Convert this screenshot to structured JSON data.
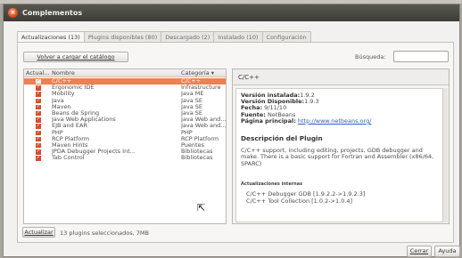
{
  "window": {
    "title": "Complementos",
    "close_icon": "close-icon"
  },
  "tabs": [
    {
      "label": "Actualizaciones (13)",
      "active": true
    },
    {
      "label": "Plugins disponibles (80)",
      "active": false
    },
    {
      "label": "Descargado (2)",
      "active": false
    },
    {
      "label": "Instalado (10)",
      "active": false
    },
    {
      "label": "Configuración",
      "active": false
    }
  ],
  "toolbar": {
    "reload_label": "Volver a cargar el catálogo",
    "search_label": "Búsqueda:",
    "search_value": ""
  },
  "list": {
    "headers": {
      "actual": "Actual...",
      "name": "Nombre",
      "category": "Categoría ▾"
    },
    "rows": [
      {
        "name": "C/C++",
        "category": "C/C++",
        "checked": true,
        "selected": true
      },
      {
        "name": "Ergonomic IDE",
        "category": "Infrastructure",
        "checked": true,
        "selected": false
      },
      {
        "name": "Mobility",
        "category": "Java ME",
        "checked": true,
        "selected": false
      },
      {
        "name": "Java",
        "category": "Java SE",
        "checked": true,
        "selected": false
      },
      {
        "name": "Maven",
        "category": "Java SE",
        "checked": true,
        "selected": false
      },
      {
        "name": "Beans de Spring",
        "category": "Java SE",
        "checked": true,
        "selected": false
      },
      {
        "name": "Java Web Applications",
        "category": "Java Web and...",
        "checked": true,
        "selected": false
      },
      {
        "name": "EJB and EAR",
        "category": "Java Web and...",
        "checked": true,
        "selected": false
      },
      {
        "name": "PHP",
        "category": "PHP",
        "checked": true,
        "selected": false
      },
      {
        "name": "RCP Platform",
        "category": "RCP Platform",
        "checked": true,
        "selected": false
      },
      {
        "name": "Maven Hints",
        "category": "Puentes",
        "checked": true,
        "selected": false
      },
      {
        "name": "JPDA Debugger Projects Int...",
        "category": "Bibliotecas",
        "checked": true,
        "selected": false
      },
      {
        "name": "Tab Control",
        "category": "Bibliotecas",
        "checked": true,
        "selected": false
      }
    ]
  },
  "detail": {
    "header": "C/C++",
    "installed_label": "Versión instalada:",
    "installed_value": "1.9.2",
    "available_label": "Versión Disponible:",
    "available_value": "1.9.3",
    "date_label": "Fecha:",
    "date_value": "9/11/10",
    "source_label": "Fuente:",
    "source_value": "NetBeans",
    "homepage_label": "Página principal:",
    "homepage_value": "http://www.netbeans.org/",
    "desc_title": "Descripción del Plugin",
    "desc_text": "C/C++ support, including editing, projects, GDB debugger and make. There is a basic support for Fortran and Assembler (x86/64, SPARC)",
    "internal_title": "Actualizaciones internas",
    "internal_items": [
      "C/C++ Debugger GDB [1.9.2.2->1.9.2.3]",
      "C/C++ Tool Collection [1.0.2->1.0.4]"
    ]
  },
  "footer": {
    "update_label": "Actualizar",
    "status_text": "13 plugins seleccionados, 7MB",
    "close_label": "Cerrar",
    "help_label": "Ayuda"
  },
  "colors": {
    "accent": "#f0804d",
    "checkbox": "#d84f26",
    "titlebar": "#3d3c37"
  }
}
